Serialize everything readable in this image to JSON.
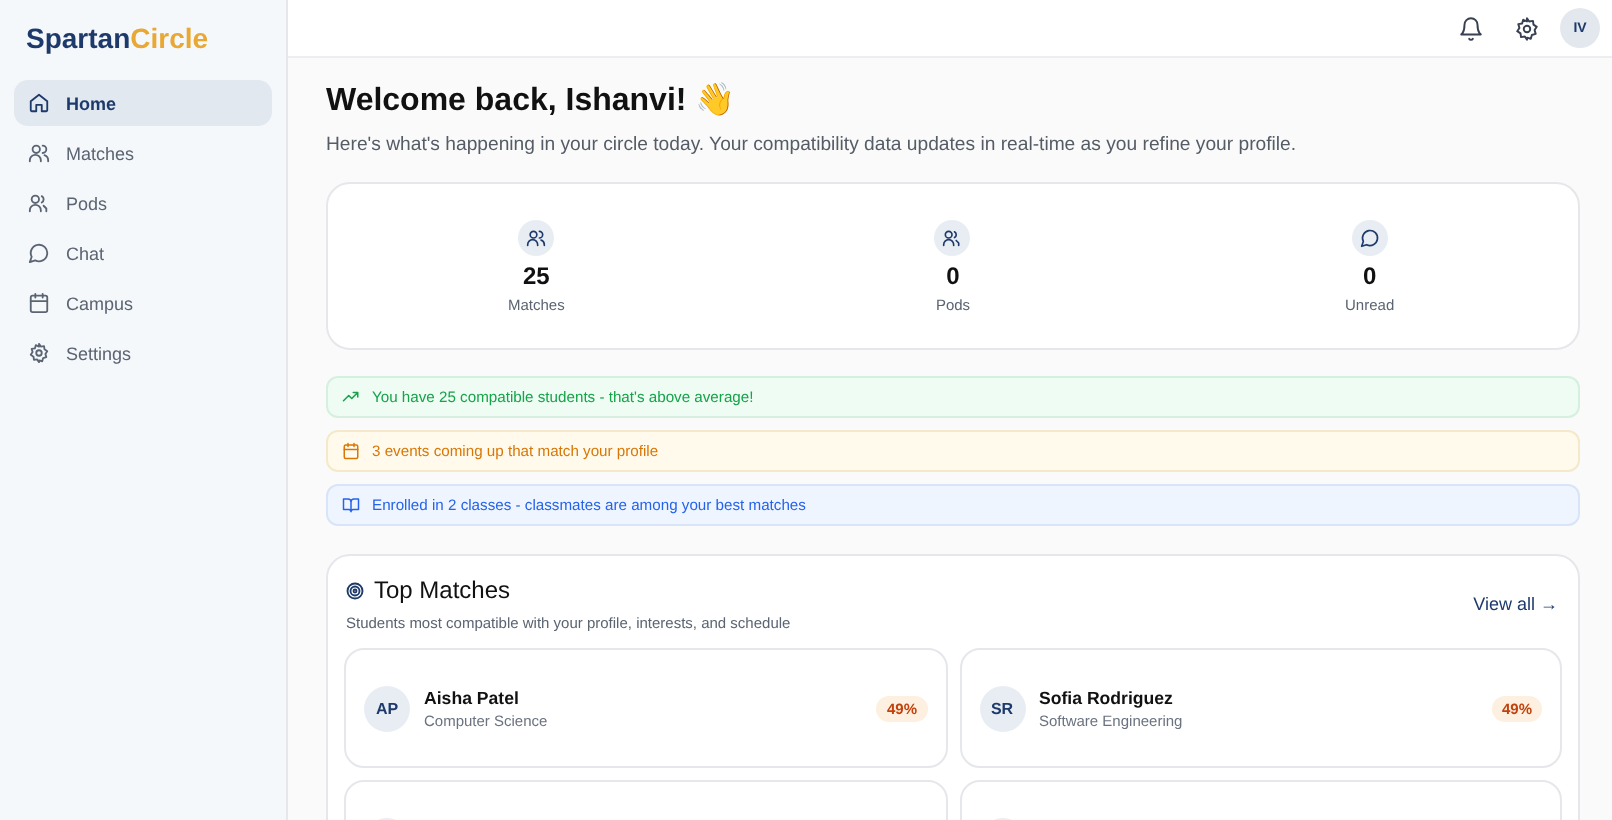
{
  "brand": {
    "part1": "Spartan",
    "part2": "Circle"
  },
  "sidebar": {
    "items": [
      {
        "label": "Home",
        "selected": true
      },
      {
        "label": "Matches",
        "selected": false
      },
      {
        "label": "Pods",
        "selected": false
      },
      {
        "label": "Chat",
        "selected": false
      },
      {
        "label": "Campus",
        "selected": false
      },
      {
        "label": "Settings",
        "selected": false
      }
    ]
  },
  "header": {
    "avatar": "IV"
  },
  "welcome": {
    "title": "Welcome back, Ishanvi! 👋",
    "subtitle": "Here's what's happening in your circle today. Your compatibility data updates in real-time as you refine your profile."
  },
  "stats": [
    {
      "value": "25",
      "label": "Matches"
    },
    {
      "value": "0",
      "label": "Pods"
    },
    {
      "value": "0",
      "label": "Unread"
    }
  ],
  "alerts": [
    {
      "kind": "success",
      "text": "You have 25 compatible students - that's above average!"
    },
    {
      "kind": "warning",
      "text": "3 events coming up that match your profile"
    },
    {
      "kind": "info",
      "text": "Enrolled in 2 classes - classmates are among your best matches"
    }
  ],
  "top_matches": {
    "title": "Top Matches",
    "subtitle": "Students most compatible with your profile, interests, and schedule",
    "view_all": "View all →",
    "cards": [
      {
        "initials": "AP",
        "name": "Aisha Patel",
        "major": "Computer Science",
        "score": "49%"
      },
      {
        "initials": "SR",
        "name": "Sofia Rodriguez",
        "major": "Software Engineering",
        "score": "49%"
      }
    ]
  }
}
